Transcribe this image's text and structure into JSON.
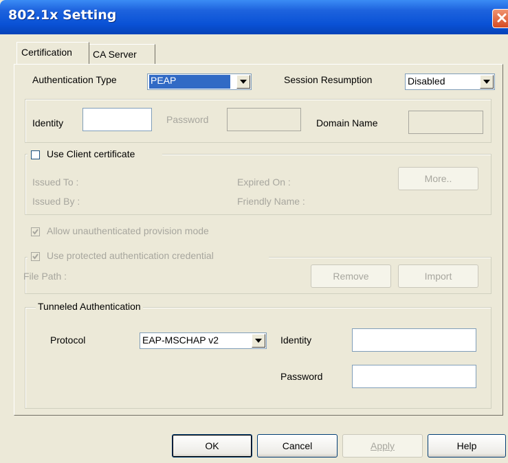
{
  "window": {
    "title": "802.1x Setting"
  },
  "tabs": [
    {
      "label": "Certification"
    },
    {
      "label": "CA Server"
    }
  ],
  "auth": {
    "type_label": "Authentication Type",
    "type_value": "PEAP",
    "session_label": "Session Resumption",
    "session_value": "Disabled"
  },
  "creds": {
    "identity_label": "Identity",
    "identity_value": "",
    "password_label": "Password",
    "password_value": "",
    "domain_label": "Domain Name",
    "domain_value": ""
  },
  "client_cert": {
    "checkbox_label": "Use Client certificate",
    "checked": false,
    "issued_to": "Issued To :",
    "issued_by": "Issued By :",
    "expired_on": "Expired On :",
    "friendly_name": "Friendly Name :",
    "more_button": "More.."
  },
  "provision": {
    "allow_label": "Allow unauthenticated provision mode",
    "allow_checked": true,
    "protected_label": "Use protected authentication credential",
    "protected_checked": true,
    "file_path": "File Path :",
    "remove_button": "Remove",
    "import_button": "Import"
  },
  "tunneled": {
    "group_label": "Tunneled Authentication",
    "protocol_label": "Protocol",
    "protocol_value": "EAP-MSCHAP v2",
    "identity_label": "Identity",
    "identity_value": "",
    "password_label": "Password",
    "password_value": ""
  },
  "footer": {
    "ok": "OK",
    "cancel": "Cancel",
    "apply": "Apply",
    "help": "Help"
  },
  "colors": {
    "titlebar": "#0A52D6",
    "face": "#ECE9D8",
    "selection": "#316AC5",
    "disabled_text": "#A7A69E"
  },
  "icons": {
    "close": "close-icon",
    "dropdown": "chevron-down-icon",
    "check": "check-icon"
  }
}
